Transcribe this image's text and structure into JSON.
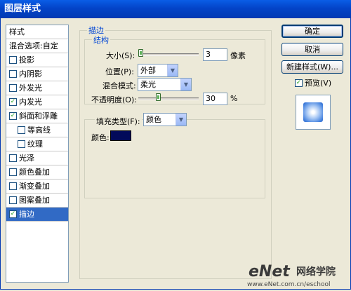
{
  "window": {
    "title": "图层样式"
  },
  "styles_list": {
    "header": "样式",
    "blend_options": "混合选项:自定",
    "items": [
      {
        "label": "投影",
        "checked": false,
        "indent": false,
        "selected": false
      },
      {
        "label": "内阴影",
        "checked": false,
        "indent": false,
        "selected": false
      },
      {
        "label": "外发光",
        "checked": false,
        "indent": false,
        "selected": false
      },
      {
        "label": "内发光",
        "checked": true,
        "indent": false,
        "selected": false
      },
      {
        "label": "斜面和浮雕",
        "checked": true,
        "indent": false,
        "selected": false
      },
      {
        "label": "等高线",
        "checked": false,
        "indent": true,
        "selected": false
      },
      {
        "label": "纹理",
        "checked": false,
        "indent": true,
        "selected": false
      },
      {
        "label": "光泽",
        "checked": false,
        "indent": false,
        "selected": false
      },
      {
        "label": "颜色叠加",
        "checked": false,
        "indent": false,
        "selected": false
      },
      {
        "label": "渐变叠加",
        "checked": false,
        "indent": false,
        "selected": false
      },
      {
        "label": "图案叠加",
        "checked": false,
        "indent": false,
        "selected": false
      },
      {
        "label": "描边",
        "checked": true,
        "indent": false,
        "selected": true
      }
    ]
  },
  "stroke": {
    "group_title": "描边",
    "structure_title": "结构",
    "size_label": "大小(S):",
    "size_value": "3",
    "size_unit": "像素",
    "position_label": "位置(P):",
    "position_value": "外部",
    "blend_mode_label": "混合模式:",
    "blend_mode_value": "柔光",
    "opacity_label": "不透明度(O):",
    "opacity_value": "30",
    "opacity_unit": "%",
    "fill_type_label": "填充类型(F):",
    "fill_type_value": "颜色",
    "color_label": "颜色:",
    "color_value": "#020a5a"
  },
  "buttons": {
    "ok": "确定",
    "cancel": "取消",
    "new_style": "新建样式(W)...",
    "preview_label": "预览(V)",
    "preview_checked": true
  },
  "watermark": {
    "logo": "eNet",
    "chinese": "网络学院",
    "url": "www.eNet.com.cn/eschool"
  }
}
